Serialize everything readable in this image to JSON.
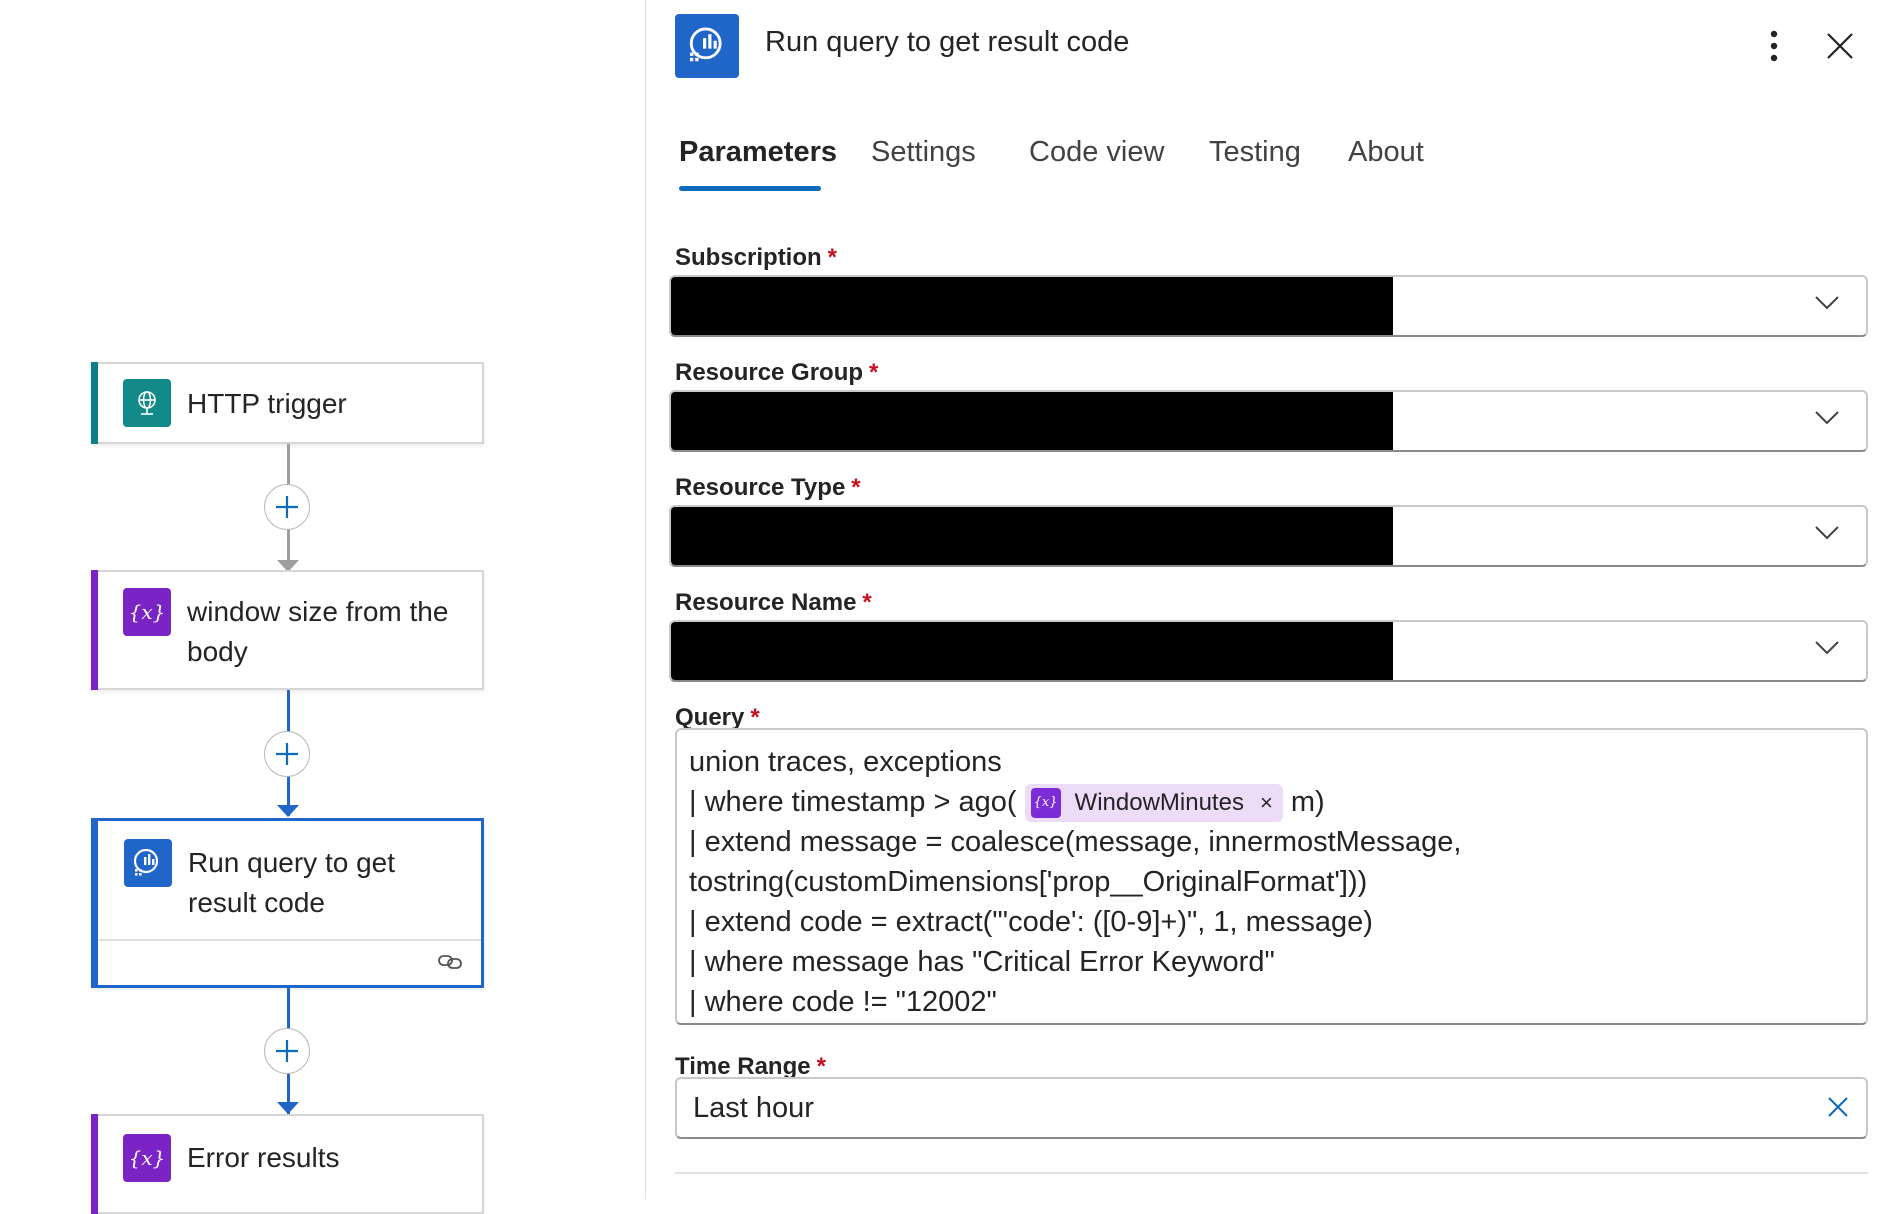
{
  "canvas": {
    "nodes": [
      {
        "title": "HTTP trigger",
        "icon": "globe-icon",
        "accent": "#0f7e8a"
      },
      {
        "title": "window size from the body",
        "icon": "variable-icon",
        "accent": "#7a24c6"
      },
      {
        "title": "Run query to get result code",
        "icon": "log-analytics-icon",
        "accent": "#1f66c8",
        "selected": true
      },
      {
        "title": "Error results",
        "icon": "variable-icon",
        "accent": "#7a24c6"
      }
    ]
  },
  "panel": {
    "title": "Run query to get result code",
    "icon": "log-analytics-icon",
    "tabs": [
      "Parameters",
      "Settings",
      "Code view",
      "Testing",
      "About"
    ],
    "active_tab": "Parameters",
    "fields": {
      "subscription": {
        "label": "Subscription",
        "required_mark": "*"
      },
      "resource_group": {
        "label": "Resource Group",
        "required_mark": "*"
      },
      "resource_type": {
        "label": "Resource Type",
        "required_mark": "*"
      },
      "resource_name": {
        "label": "Resource Name",
        "required_mark": "*"
      },
      "query": {
        "label": "Query",
        "required_mark": "*",
        "line1": "union traces, exceptions",
        "line2_before": "| where timestamp > ago(",
        "token": "WindowMinutes",
        "token_close": "×",
        "line2_after": "m)",
        "line3": "| extend message = coalesce(message, innermostMessage,",
        "line4": "tostring(customDimensions['prop__OriginalFormat']))",
        "line5": "| extend code = extract(\"'code': ([0-9]+)\", 1, message)",
        "line6": "| where message has \"Critical Error Keyword\"",
        "line7": "| where code != \"12002\""
      },
      "time_range": {
        "label": "Time Range",
        "required_mark": "*",
        "value": "Last hour"
      }
    }
  },
  "colors": {
    "accent_blue": "#0f6cbd",
    "variable_purple": "#7a24c6",
    "required_red": "#c50f1f"
  }
}
